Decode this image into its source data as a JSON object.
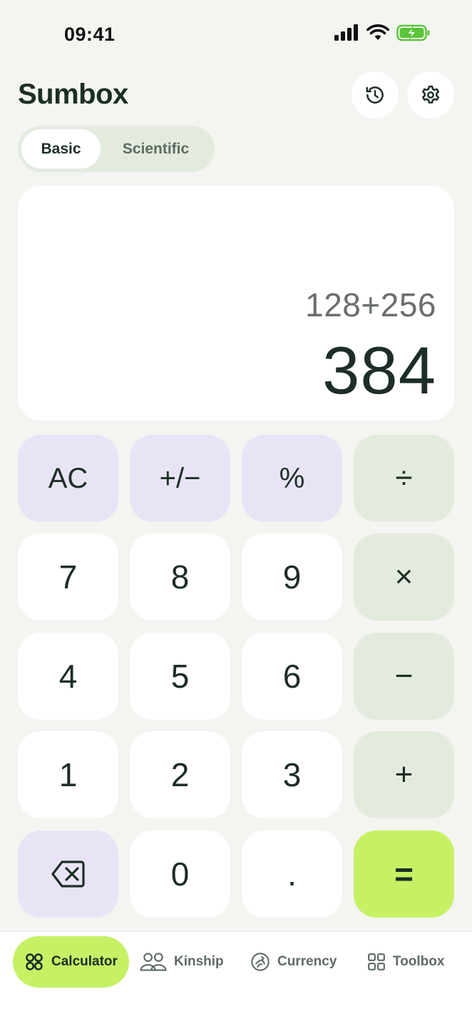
{
  "status_bar": {
    "time": "09:41"
  },
  "header": {
    "title": "Sumbox"
  },
  "mode_tabs": [
    "Basic",
    "Scientific"
  ],
  "display": {
    "expression": "128+256",
    "result": "384"
  },
  "keys": {
    "ac": "AC",
    "sign": "+/−",
    "percent": "%",
    "divide": "÷",
    "seven": "7",
    "eight": "8",
    "nine": "9",
    "multiply": "×",
    "four": "4",
    "five": "5",
    "six": "6",
    "minus": "−",
    "one": "1",
    "two": "2",
    "three": "3",
    "plus": "+",
    "zero": "0",
    "dot": ".",
    "equals": "="
  },
  "nav": [
    "Calculator",
    "Kinship",
    "Currency",
    "Toolbox"
  ],
  "colors": {
    "accent": "#c6f165",
    "function_key": "#e8e4f6",
    "operator_key": "#e3ebde",
    "text": "#1c2e25"
  }
}
